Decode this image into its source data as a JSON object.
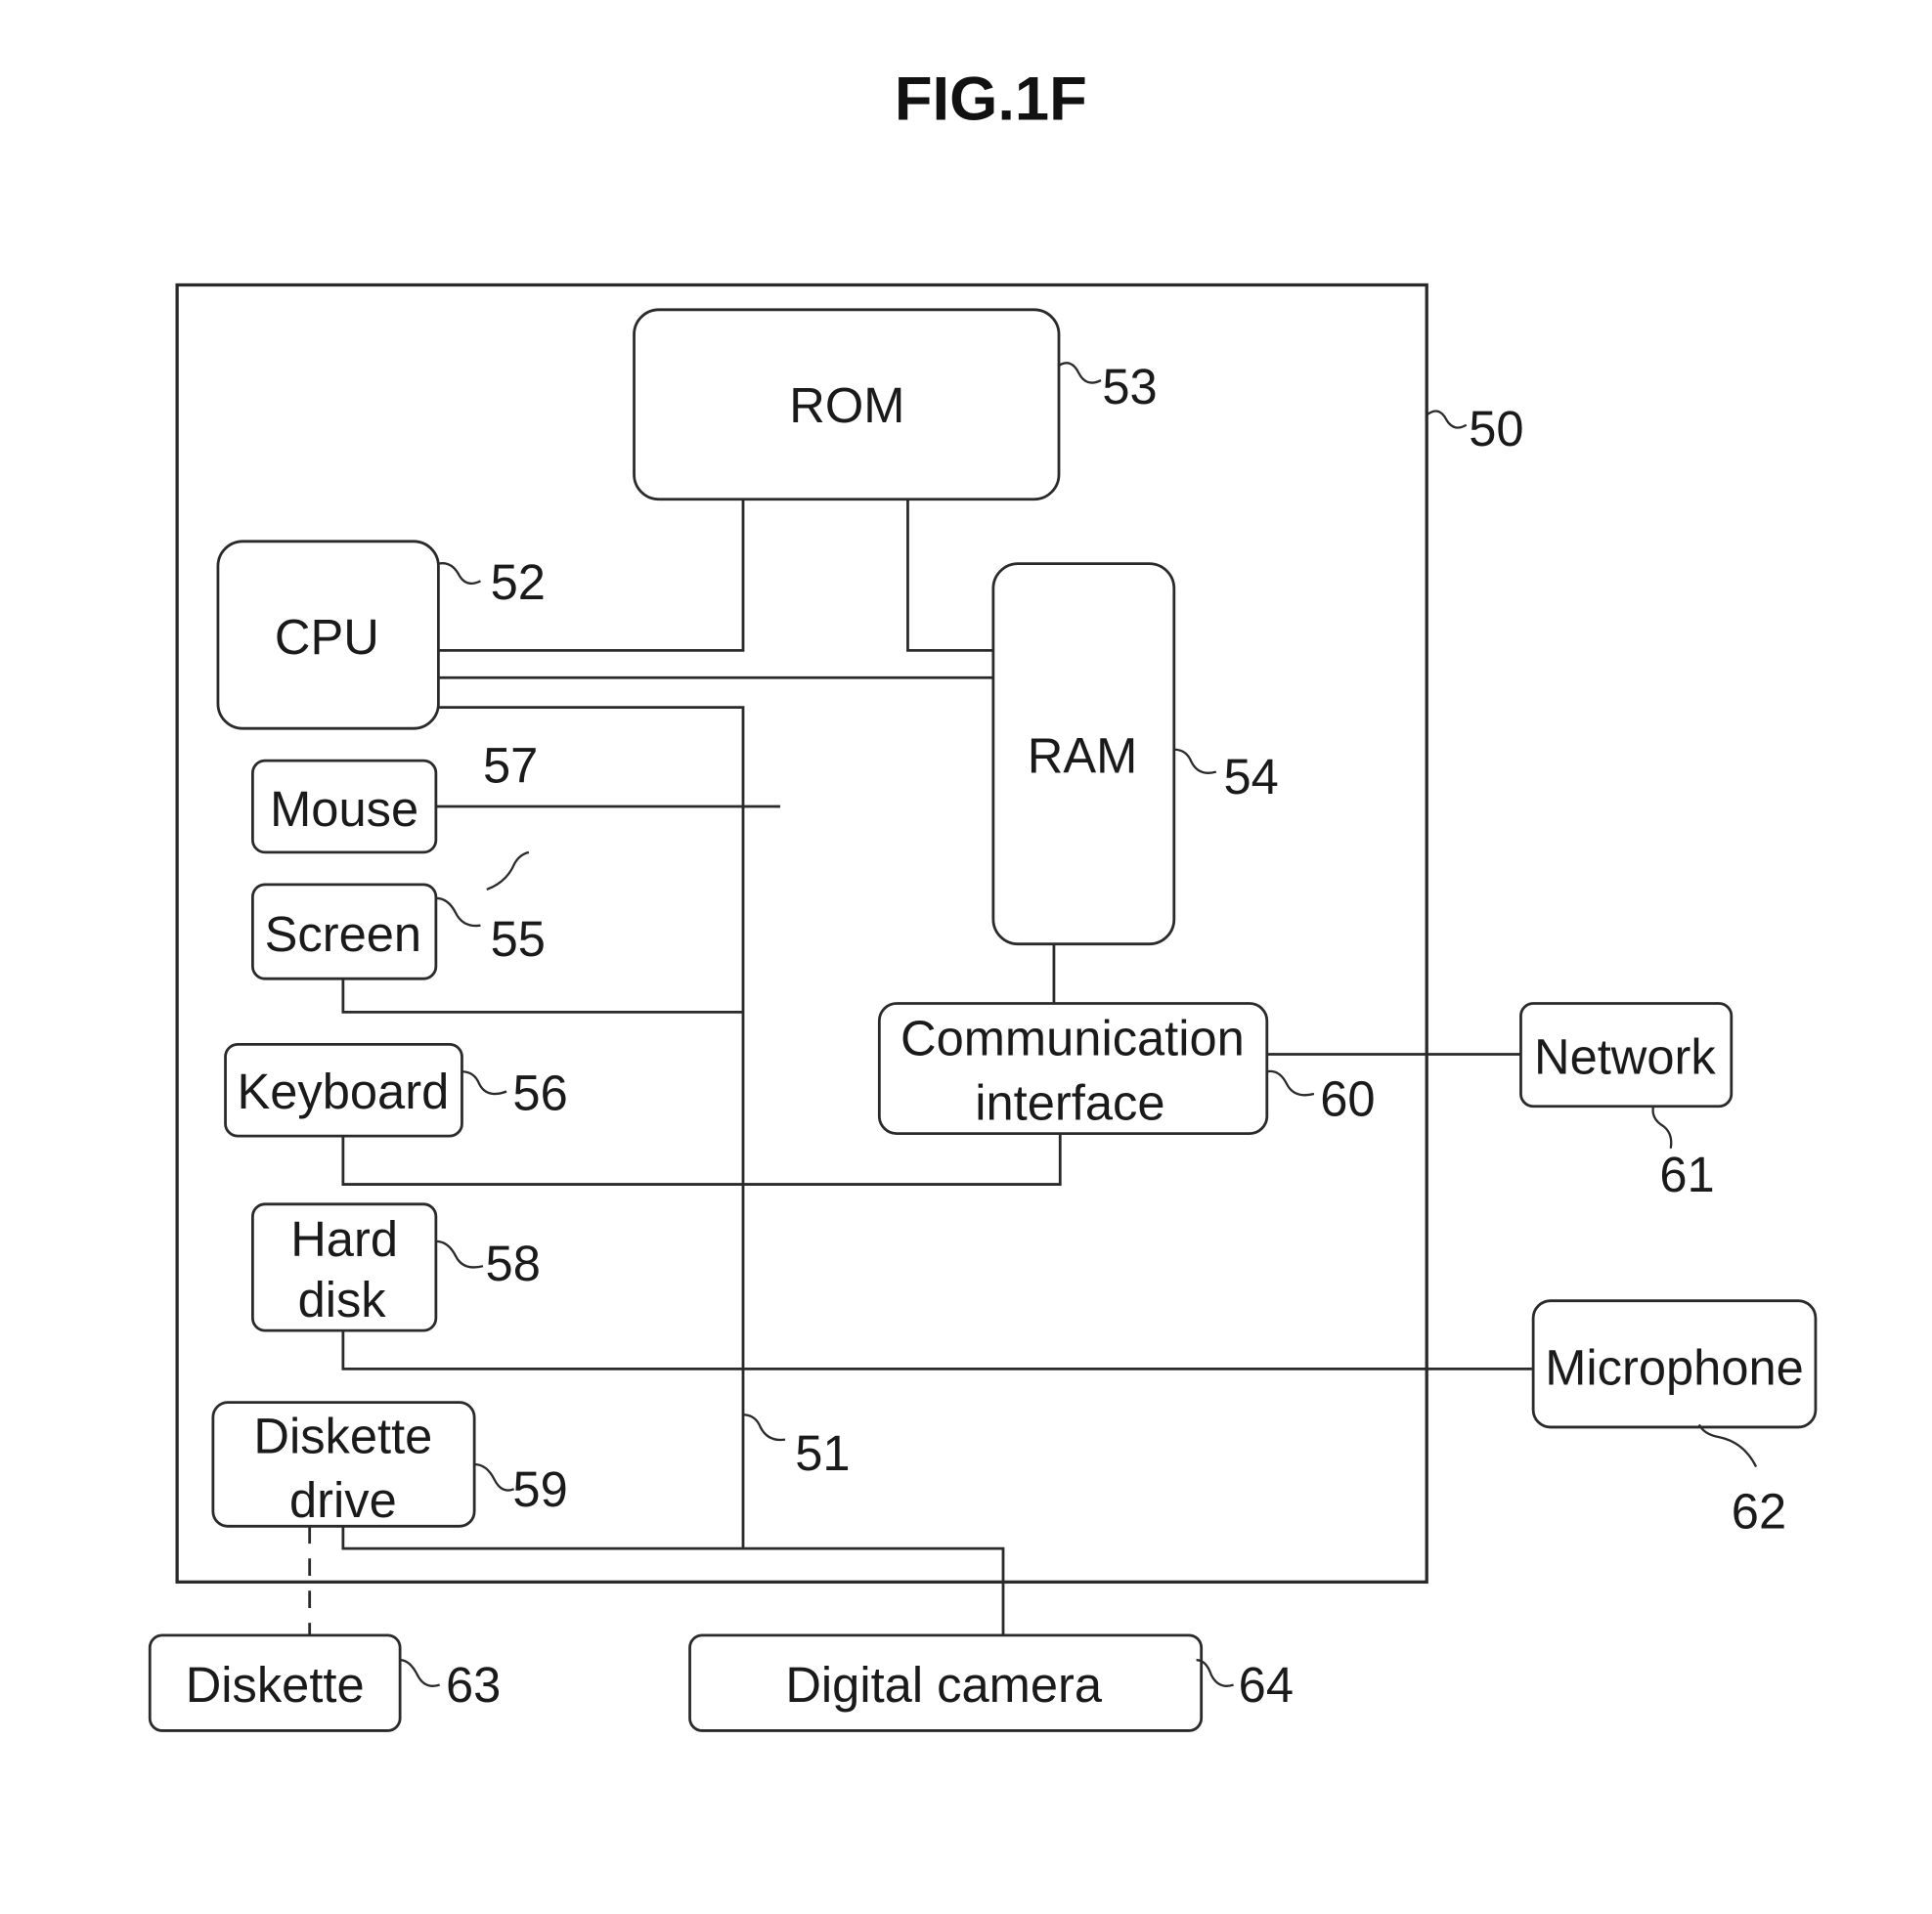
{
  "figure": {
    "title": "FIG.1F"
  },
  "system": {
    "ref": "50",
    "bus_ref": "51"
  },
  "components": {
    "rom": {
      "label": "ROM",
      "ref": "53"
    },
    "cpu": {
      "label": "CPU",
      "ref": "52"
    },
    "ram": {
      "label": "RAM",
      "ref": "54"
    },
    "mouse": {
      "label": "Mouse",
      "ref": "57"
    },
    "screen": {
      "label": "Screen",
      "ref": "55"
    },
    "keyboard": {
      "label": "Keyboard",
      "ref": "56"
    },
    "comm_interface": {
      "label_line1": "Communication",
      "label_line2": "interface",
      "ref": "60"
    },
    "network": {
      "label": "Network",
      "ref": "61"
    },
    "hard_disk": {
      "label_line1": "Hard",
      "label_line2": "disk",
      "ref": "58"
    },
    "microphone": {
      "label": "Microphone",
      "ref": "62"
    },
    "diskette_drive": {
      "label_line1": "Diskette",
      "label_line2": "drive",
      "ref": "59"
    },
    "diskette": {
      "label": "Diskette",
      "ref": "63"
    },
    "digital_camera": {
      "label": "Digital camera",
      "ref": "64"
    }
  }
}
